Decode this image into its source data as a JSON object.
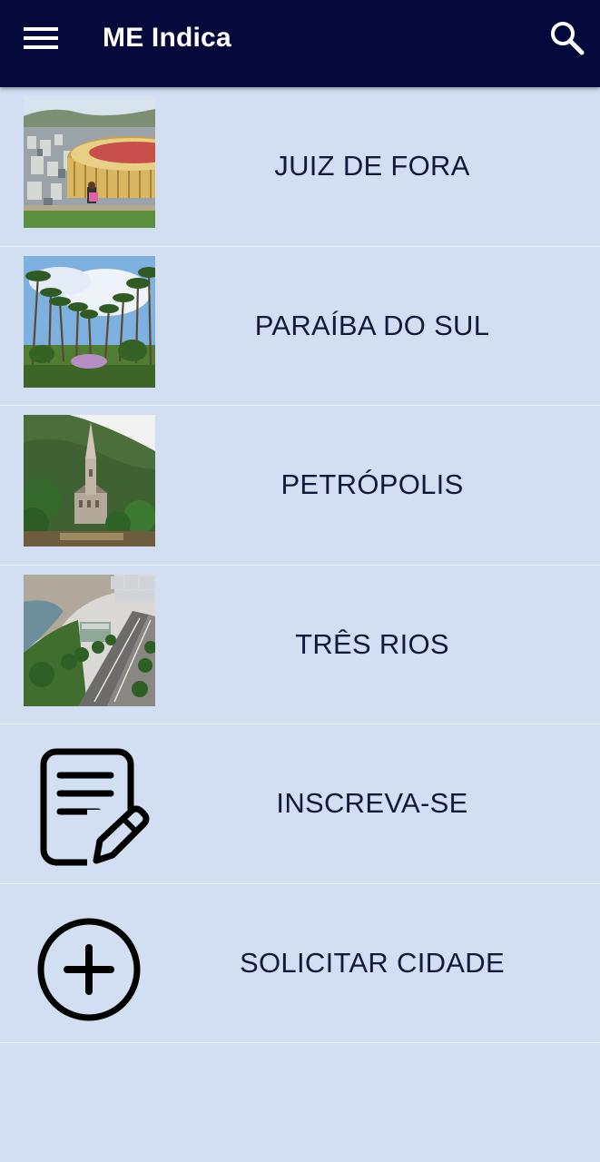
{
  "app_bar": {
    "title": "ME Indica",
    "menu_icon": "menu-icon",
    "search_icon": "search-icon",
    "background": "#04083a"
  },
  "cities": [
    {
      "label": "JUIZ DE FORA",
      "image": "juiz-de-fora-thumbnail"
    },
    {
      "label": "PARAÍBA DO SUL",
      "image": "paraiba-do-sul-thumbnail"
    },
    {
      "label": "PETRÓPOLIS",
      "image": "petropolis-thumbnail"
    },
    {
      "label": "TRÊS RIOS",
      "image": "tres-rios-thumbnail"
    }
  ],
  "actions": [
    {
      "label": "INSCREVA-SE",
      "icon": "edit-document-icon"
    },
    {
      "label": "SOLICITAR CIDADE",
      "icon": "add-circle-icon"
    }
  ],
  "colors": {
    "list_background": "#d2def2",
    "text": "#14183a",
    "divider": "#eef3fb"
  }
}
